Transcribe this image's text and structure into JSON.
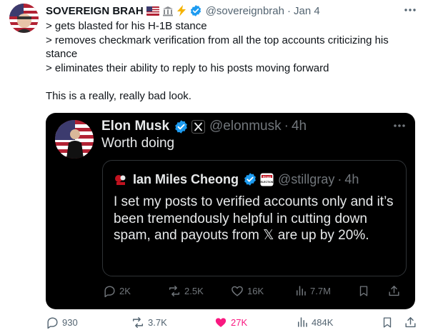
{
  "post": {
    "display_name": "SOVEREIGN BRAH",
    "handle": "@sovereignbrah",
    "time": "Jan 4",
    "emoji_icons": [
      "us-flag-icon",
      "classical-building-icon",
      "lightning-icon"
    ],
    "text": "> gets blasted for his H-1B stance\n> removes checkmark verification from all the top accounts criticizing his stance\n> eliminates their ability to reply to his posts moving forward\n\nThis is a really, really bad look.",
    "stats": {
      "replies": "930",
      "reposts": "3.7K",
      "likes": "27K",
      "views": "484K"
    }
  },
  "quote": {
    "display_name": "Elon Musk",
    "handle": "@elonmusk",
    "time": "4h",
    "text": "Worth doing",
    "stats": {
      "replies": "2K",
      "reposts": "2.5K",
      "likes": "16K",
      "views": "7.7M"
    },
    "nested": {
      "display_name": "Ian Miles Cheong",
      "handle": "@stillgray",
      "time": "4h",
      "badge_text": "ROAD ELECTION",
      "text": "I set my posts to verified accounts only and it’s been tremendously helpful in cutting down spam, and payouts from 𝕏 are up by 20%."
    }
  },
  "colors": {
    "verified_blue": "#1d9bf0",
    "like_pink": "#f91880",
    "muted_light": "#536471",
    "muted_dark": "#71767b",
    "card_bg": "#000000"
  },
  "separator": "·"
}
